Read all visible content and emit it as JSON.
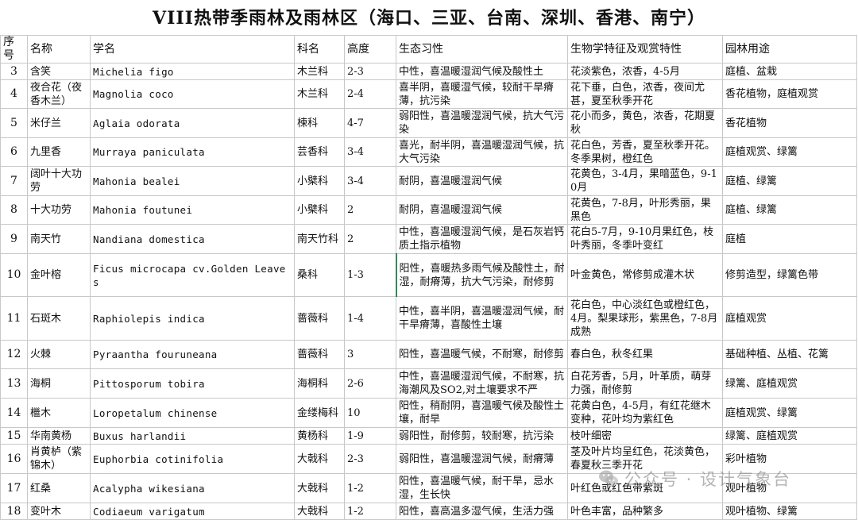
{
  "title": "VIII热带季雨林及雨林区（海口、三亚、台南、深圳、香港、南宁）",
  "headers": [
    "序号",
    "名称",
    "学名",
    "科名",
    "高度",
    "生态习性",
    "生物学特征及观赏特性",
    "园林用途"
  ],
  "rows": [
    {
      "no": "3",
      "name": "含笑",
      "sci": "Michelia figo",
      "family": "木兰科",
      "height": "2-3",
      "ecology": "中性，喜温暖湿润气候及酸性土",
      "features": "花淡紫色，浓香，4-5月",
      "use": "庭植、盆栽"
    },
    {
      "no": "4",
      "name": "夜合花（夜香木兰）",
      "sci": "Magnolia coco",
      "family": "木兰科",
      "height": "2-4",
      "ecology": "喜半阴，喜暖湿气候，较耐干旱瘠薄，抗污染",
      "features": "花下垂，白色，浓香，夜间尤甚，夏至秋季开花",
      "use": "香花植物，庭植观赏"
    },
    {
      "no": "5",
      "name": "米仔兰",
      "sci": "Aglaia odorata",
      "family": "楝科",
      "height": "4-7",
      "ecology": "弱阳性，喜温暖湿润气候，抗大气污染",
      "features": "花小而多，黄色，浓香，花期夏秋",
      "use": "香花植物"
    },
    {
      "no": "6",
      "name": "九里香",
      "sci": "Murraya paniculata",
      "family": "芸香科",
      "height": "3-4",
      "ecology": "喜光，耐半阴，喜温暖湿润气候，抗大气污染",
      "features": "花白色，芳香，夏至秋季开花。冬季果树，橙红色",
      "use": "庭植观赏、绿篱"
    },
    {
      "no": "7",
      "name": "阔叶十大功劳",
      "sci": "Mahonia bealei",
      "family": "小檗科",
      "height": "3-4",
      "ecology": "耐阴，喜温暖湿润气候",
      "features": "花黄色，3-4月，果暗蓝色，9-10月",
      "use": "庭植、绿篱"
    },
    {
      "no": "8",
      "name": "十大功劳",
      "sci": "Mahonia foutunei",
      "family": "小檗科",
      "height": "2",
      "ecology": "耐阴，喜温暖湿润气候",
      "features": "花黄色，7-8月，叶形秀丽，果黑色",
      "use": "庭植、绿篱"
    },
    {
      "no": "9",
      "name": "南天竹",
      "sci": "Nandiana domestica",
      "family": "南天竹科",
      "height": "2",
      "ecology": "中性，喜温暖湿润气候，是石灰岩钙质土指示植物",
      "features": "花白5-7月，9-10月果红色，枝叶秀丽，冬季叶变红",
      "use": "庭植"
    },
    {
      "no": "10",
      "name": "金叶榕",
      "sci": "Ficus microcapa cv.Golden Leaves",
      "family": "桑科",
      "height": "1-3",
      "ecology": "阳性，喜暖热多雨气候及酸性土，耐湿，耐瘠薄，抗大气污染，耐修剪",
      "features": "叶金黄色，常修剪成灌木状",
      "use": "修剪造型，绿篱色带"
    },
    {
      "no": "11",
      "name": "石斑木",
      "sci": "Raphiolepis indica",
      "family": "蔷薇科",
      "height": "1-4",
      "ecology": "中性，喜半阴，喜温暖湿润气候，耐干旱瘠薄，喜酸性土壤",
      "features": "花白色，中心淡红色或橙红色，4月。梨果球形，紫黑色，7-8月成熟",
      "use": "庭植观赏"
    },
    {
      "no": "12",
      "name": "火棘",
      "sci": "Pyraantha fouruneana",
      "family": "蔷薇科",
      "height": "3",
      "ecology": "阳性，喜温暖气候，不耐寒，耐修剪",
      "features": "春白色，秋冬红果",
      "use": "基础种植、丛植、花篱"
    },
    {
      "no": "13",
      "name": "海桐",
      "sci": "Pittosporum tobira",
      "family": "海桐科",
      "height": "2-6",
      "ecology": "中性，喜温暖湿润气候，不耐寒，抗海潮风及SO2,对土壤要求不严",
      "features": "白花芳香，5月，叶革质，萌芽力强，耐修剪",
      "use": "绿篱、庭植观赏"
    },
    {
      "no": "14",
      "name": "檵木",
      "sci": "Loropetalum chinense",
      "family": "金缕梅科",
      "height": "10",
      "ecology": "阳性，稍耐阴，喜温暖气候及酸性土壤，耐旱",
      "features": "花黄白色，4-5月，有红花继木变种，花叶均为紫红色",
      "use": "庭植观赏、绿篱"
    },
    {
      "no": "15",
      "name": "华南黄杨",
      "sci": "Buxus harlandii",
      "family": "黄杨科",
      "height": "1-9",
      "ecology": "弱阳性，耐修剪，较耐寒，抗污染",
      "features": "枝叶细密",
      "use": "绿篱、庭植观赏"
    },
    {
      "no": "16",
      "name": "肖黄栌（紫锦木）",
      "sci": "Euphorbia cotinifolia",
      "family": "大戟科",
      "height": "2-3",
      "ecology": "弱阳性，喜温暖湿润气候，耐瘠薄",
      "features": "茎及叶片均呈红色，花淡黄色，春夏秋三季开花",
      "use": "彩叶植物"
    },
    {
      "no": "17",
      "name": "红桑",
      "sci": "Acalypha wikesiana",
      "family": "大戟科",
      "height": "1-2",
      "ecology": "阳性，喜温暖气候，耐干旱，忌水湿，生长快",
      "features": "叶红色或红色带紫斑",
      "use": "观叶植物"
    },
    {
      "no": "18",
      "name": "变叶木",
      "sci": "Codiaeum varigatum",
      "family": "大戟科",
      "height": "1-2",
      "ecology": "阳性，喜高温多湿气候，生活力强",
      "features": "叶色丰富，品种繁多",
      "use": "观叶植物、绿篱"
    }
  ],
  "watermark": {
    "text": "公众号 · 设计气象台",
    "icon": "wechat-icon"
  }
}
